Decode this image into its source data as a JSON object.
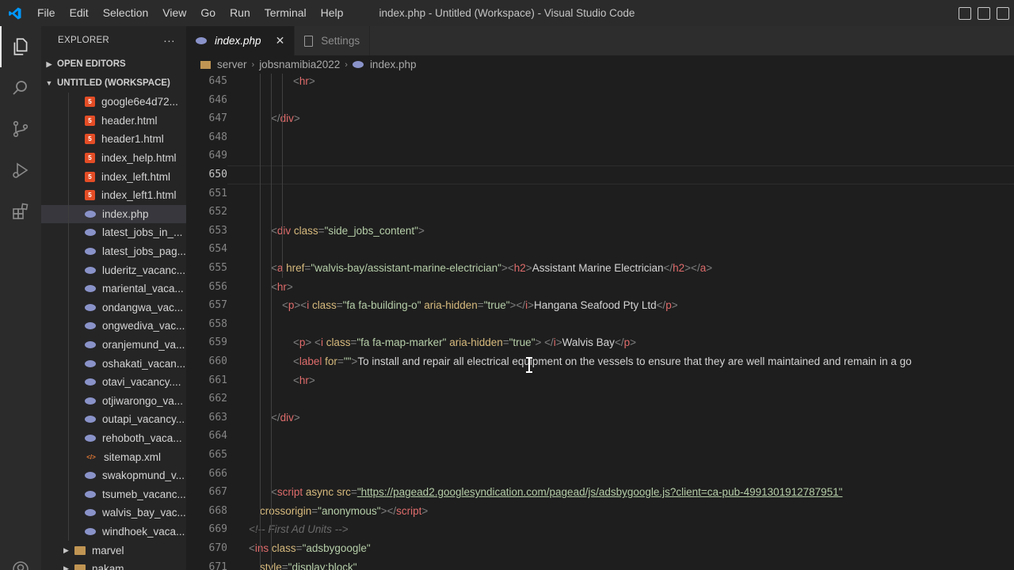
{
  "menu": [
    "File",
    "Edit",
    "Selection",
    "View",
    "Go",
    "Run",
    "Terminal",
    "Help"
  ],
  "window_title": "index.php - Untitled (Workspace) - Visual Studio Code",
  "sidebar": {
    "title": "EXPLORER",
    "more": "···",
    "open_editors": "OPEN EDITORS",
    "workspace": "UNTITLED (WORKSPACE)",
    "files": [
      {
        "name": "google6e4d72...",
        "type": "html"
      },
      {
        "name": "header.html",
        "type": "html"
      },
      {
        "name": "header1.html",
        "type": "html"
      },
      {
        "name": "index_help.html",
        "type": "html"
      },
      {
        "name": "index_left.html",
        "type": "html"
      },
      {
        "name": "index_left1.html",
        "type": "html"
      },
      {
        "name": "index.php",
        "type": "php",
        "selected": true
      },
      {
        "name": "latest_jobs_in_...",
        "type": "php"
      },
      {
        "name": "latest_jobs_pag...",
        "type": "php"
      },
      {
        "name": "luderitz_vacanc...",
        "type": "php"
      },
      {
        "name": "mariental_vaca...",
        "type": "php"
      },
      {
        "name": "ondangwa_vac...",
        "type": "php"
      },
      {
        "name": "ongwediva_vac...",
        "type": "php"
      },
      {
        "name": "oranjemund_va...",
        "type": "php"
      },
      {
        "name": "oshakati_vacan...",
        "type": "php"
      },
      {
        "name": "otavi_vacancy....",
        "type": "php"
      },
      {
        "name": "otjiwarongo_va...",
        "type": "php"
      },
      {
        "name": "outapi_vacancy...",
        "type": "php"
      },
      {
        "name": "rehoboth_vaca...",
        "type": "php"
      },
      {
        "name": "sitemap.xml",
        "type": "xml"
      },
      {
        "name": "swakopmund_v...",
        "type": "php"
      },
      {
        "name": "tsumeb_vacanc...",
        "type": "php"
      },
      {
        "name": "walvis_bay_vac...",
        "type": "php"
      },
      {
        "name": "windhoek_vaca...",
        "type": "php"
      }
    ],
    "folders": [
      "marvel",
      "nakam"
    ]
  },
  "tabs": [
    {
      "label": "index.php",
      "active": true,
      "close": "✕"
    },
    {
      "label": "Settings",
      "active": false
    }
  ],
  "breadcrumb": [
    "server",
    "jobsnamibia2022",
    "index.php"
  ],
  "editor": {
    "current_line": 650,
    "lines": [
      {
        "n": 645,
        "tokens": [
          {
            "t": "punc",
            "v": "<"
          },
          {
            "t": "tag",
            "v": "hr"
          },
          {
            "t": "punc",
            "v": ">"
          }
        ],
        "indent": 4
      },
      {
        "n": 646,
        "tokens": [],
        "indent": 0
      },
      {
        "n": 647,
        "tokens": [
          {
            "t": "punc",
            "v": "</"
          },
          {
            "t": "tag",
            "v": "div"
          },
          {
            "t": "punc",
            "v": ">"
          }
        ],
        "indent": 2
      },
      {
        "n": 648,
        "tokens": [],
        "indent": 0
      },
      {
        "n": 649,
        "tokens": [],
        "indent": 0
      },
      {
        "n": 650,
        "tokens": [],
        "indent": 0
      },
      {
        "n": 651,
        "tokens": [],
        "indent": 0
      },
      {
        "n": 652,
        "tokens": [],
        "indent": 0
      },
      {
        "n": 653,
        "tokens": [
          {
            "t": "punc",
            "v": "<"
          },
          {
            "t": "tag",
            "v": "div "
          },
          {
            "t": "attr",
            "v": "class"
          },
          {
            "t": "punc",
            "v": "="
          },
          {
            "t": "str",
            "v": "\"side_jobs_content\""
          },
          {
            "t": "punc",
            "v": ">"
          }
        ],
        "indent": 2
      },
      {
        "n": 654,
        "tokens": [],
        "indent": 0
      },
      {
        "n": 655,
        "tokens": [
          {
            "t": "punc",
            "v": "<"
          },
          {
            "t": "tag",
            "v": "a "
          },
          {
            "t": "attr",
            "v": "href"
          },
          {
            "t": "punc",
            "v": "="
          },
          {
            "t": "str",
            "v": "\"walvis-bay/assistant-marine-electrician\""
          },
          {
            "t": "punc",
            "v": "><"
          },
          {
            "t": "tag",
            "v": "h2"
          },
          {
            "t": "punc",
            "v": ">"
          },
          {
            "t": "txt",
            "v": "Assistant Marine Electrician"
          },
          {
            "t": "punc",
            "v": "</"
          },
          {
            "t": "tag",
            "v": "h2"
          },
          {
            "t": "punc",
            "v": "></"
          },
          {
            "t": "tag",
            "v": "a"
          },
          {
            "t": "punc",
            "v": ">"
          }
        ],
        "indent": 2
      },
      {
        "n": 656,
        "tokens": [
          {
            "t": "punc",
            "v": "<"
          },
          {
            "t": "tag",
            "v": "hr"
          },
          {
            "t": "punc",
            "v": ">"
          }
        ],
        "indent": 2
      },
      {
        "n": 657,
        "tokens": [
          {
            "t": "punc",
            "v": "<"
          },
          {
            "t": "tag",
            "v": "p"
          },
          {
            "t": "punc",
            "v": "><"
          },
          {
            "t": "tag",
            "v": "i "
          },
          {
            "t": "attr",
            "v": "class"
          },
          {
            "t": "punc",
            "v": "="
          },
          {
            "t": "str",
            "v": "\"fa fa-building-o\" "
          },
          {
            "t": "attr",
            "v": "aria-hidden"
          },
          {
            "t": "punc",
            "v": "="
          },
          {
            "t": "str",
            "v": "\"true\""
          },
          {
            "t": "punc",
            "v": "></"
          },
          {
            "t": "tag",
            "v": "i"
          },
          {
            "t": "punc",
            "v": ">"
          },
          {
            "t": "txt",
            "v": "Hangana Seafood Pty Ltd"
          },
          {
            "t": "punc",
            "v": "</"
          },
          {
            "t": "tag",
            "v": "p"
          },
          {
            "t": "punc",
            "v": ">"
          }
        ],
        "indent": 3
      },
      {
        "n": 658,
        "tokens": [],
        "indent": 0
      },
      {
        "n": 659,
        "tokens": [
          {
            "t": "punc",
            "v": "<"
          },
          {
            "t": "tag",
            "v": "p"
          },
          {
            "t": "punc",
            "v": "> <"
          },
          {
            "t": "tag",
            "v": "i "
          },
          {
            "t": "attr",
            "v": "class"
          },
          {
            "t": "punc",
            "v": "="
          },
          {
            "t": "str",
            "v": "\"fa fa-map-marker\" "
          },
          {
            "t": "attr",
            "v": "aria-hidden"
          },
          {
            "t": "punc",
            "v": "="
          },
          {
            "t": "str",
            "v": "\"true\""
          },
          {
            "t": "punc",
            "v": "> </"
          },
          {
            "t": "tag",
            "v": "i"
          },
          {
            "t": "punc",
            "v": ">"
          },
          {
            "t": "txt",
            "v": "Walvis Bay"
          },
          {
            "t": "punc",
            "v": "</"
          },
          {
            "t": "tag",
            "v": "p"
          },
          {
            "t": "punc",
            "v": ">"
          }
        ],
        "indent": 4
      },
      {
        "n": 660,
        "tokens": [
          {
            "t": "punc",
            "v": "<"
          },
          {
            "t": "tag",
            "v": "label "
          },
          {
            "t": "attr",
            "v": "for"
          },
          {
            "t": "punc",
            "v": "="
          },
          {
            "t": "str",
            "v": "\"\""
          },
          {
            "t": "punc",
            "v": ">"
          },
          {
            "t": "txt",
            "v": "To install and repair all electrical equipment on the vessels to ensure that they are well maintained and remain in a go"
          }
        ],
        "indent": 4
      },
      {
        "n": 661,
        "tokens": [
          {
            "t": "punc",
            "v": "<"
          },
          {
            "t": "tag",
            "v": "hr"
          },
          {
            "t": "punc",
            "v": ">"
          }
        ],
        "indent": 4
      },
      {
        "n": 662,
        "tokens": [],
        "indent": 0
      },
      {
        "n": 663,
        "tokens": [
          {
            "t": "punc",
            "v": "</"
          },
          {
            "t": "tag",
            "v": "div"
          },
          {
            "t": "punc",
            "v": ">"
          }
        ],
        "indent": 2
      },
      {
        "n": 664,
        "tokens": [],
        "indent": 0
      },
      {
        "n": 665,
        "tokens": [],
        "indent": 0
      },
      {
        "n": 666,
        "tokens": [],
        "indent": 0
      },
      {
        "n": 667,
        "tokens": [
          {
            "t": "punc",
            "v": "<"
          },
          {
            "t": "tag",
            "v": "script "
          },
          {
            "t": "attr",
            "v": "async "
          },
          {
            "t": "attr",
            "v": "src"
          },
          {
            "t": "punc",
            "v": "="
          },
          {
            "t": "url",
            "v": "\"https://pagead2.googlesyndication.com/pagead/js/adsbygoogle.js?client=ca-pub-4991301912787951\""
          }
        ],
        "indent": 2
      },
      {
        "n": 668,
        "tokens": [
          {
            "t": "attr",
            "v": "crossorigin"
          },
          {
            "t": "punc",
            "v": "="
          },
          {
            "t": "str",
            "v": "\"anonymous\""
          },
          {
            "t": "punc",
            "v": "></"
          },
          {
            "t": "tag",
            "v": "script"
          },
          {
            "t": "punc",
            "v": ">"
          }
        ],
        "indent": 1
      },
      {
        "n": 669,
        "tokens": [
          {
            "t": "com",
            "v": "<!-- First Ad Units -->"
          }
        ],
        "indent": 0
      },
      {
        "n": 670,
        "tokens": [
          {
            "t": "punc",
            "v": "<"
          },
          {
            "t": "tag",
            "v": "ins "
          },
          {
            "t": "attr",
            "v": "class"
          },
          {
            "t": "punc",
            "v": "="
          },
          {
            "t": "str",
            "v": "\"adsbygoogle\""
          }
        ],
        "indent": 0
      },
      {
        "n": 671,
        "tokens": [
          {
            "t": "attr",
            "v": "style"
          },
          {
            "t": "punc",
            "v": "="
          },
          {
            "t": "str",
            "v": "\"display:block\""
          }
        ],
        "indent": 1
      }
    ]
  },
  "colors": {
    "accent": "#0098ff",
    "tag": "#e06c6c",
    "attr": "#d7ba7d",
    "string": "#b5cea8",
    "html_icon": "#e44d26",
    "php_icon": "#8a93c9"
  }
}
